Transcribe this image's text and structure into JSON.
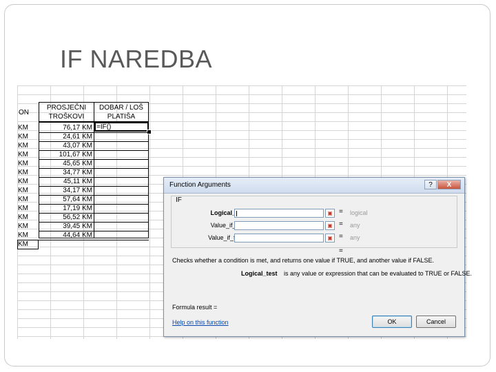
{
  "slide": {
    "title": "IF NAREDBA"
  },
  "sheet": {
    "header_col_a": "ON",
    "header_col_b": [
      "PROSJEČNI",
      "TROŠKOVI"
    ],
    "header_col_c": [
      "DOBAR / LOŠ",
      "PLATIŠA"
    ],
    "active_cell_formula": "=IF()",
    "rows": [
      {
        "a": "KM",
        "b": "76,17 KM"
      },
      {
        "a": "KM",
        "b": "24,61 KM"
      },
      {
        "a": "KM",
        "b": "43,07 KM"
      },
      {
        "a": "KM",
        "b": "101,67 KM"
      },
      {
        "a": "KM",
        "b": "45,65 KM"
      },
      {
        "a": "KM",
        "b": "34,77 KM"
      },
      {
        "a": "KM",
        "b": "45,11 KM"
      },
      {
        "a": "KM",
        "b": "34,17 KM"
      },
      {
        "a": "KM",
        "b": "57,64 KM"
      },
      {
        "a": "KM",
        "b": "17,19 KM"
      },
      {
        "a": "KM",
        "b": "56,52 KM"
      },
      {
        "a": "KM",
        "b": "39,45 KM"
      },
      {
        "a": "KM",
        "b": "44,64 KM"
      },
      {
        "a": "KM",
        "b": ""
      }
    ]
  },
  "dialog": {
    "title": "Function Arguments",
    "help_btn": "?",
    "close_btn": "X",
    "function_name": "IF",
    "args": [
      {
        "label": "Logical_test",
        "value": "",
        "result": "logical"
      },
      {
        "label": "Value_if_true",
        "value": "",
        "result": "any"
      },
      {
        "label": "Value_if_false",
        "value": "",
        "result": "any"
      }
    ],
    "equals": "=",
    "result_eq": "=",
    "description": "Checks whether a condition is met, and returns one value if TRUE, and another value if FALSE.",
    "arg_desc_name": "Logical_test",
    "arg_desc_text": "is any value or expression that can be evaluated to TRUE or FALSE.",
    "formula_result": "Formula result =",
    "help_link": "Help on this function",
    "ok_label": "OK",
    "cancel_label": "Cancel"
  }
}
